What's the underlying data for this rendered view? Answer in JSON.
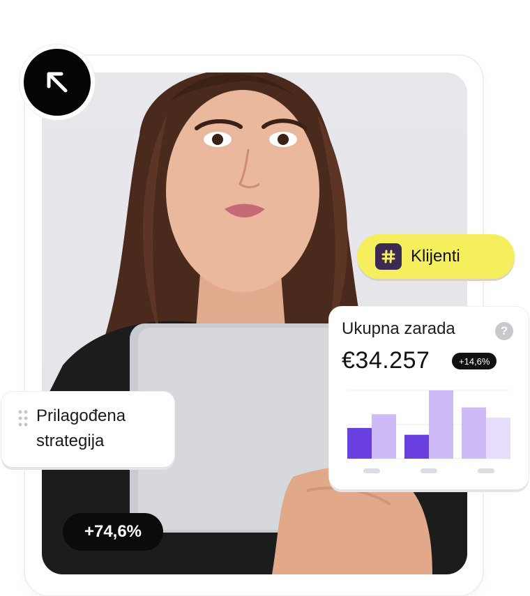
{
  "badges": {
    "clients_label": "Klijenti",
    "strategy_label_line1": "Prilagođena",
    "strategy_label_line2": "strategija",
    "growth_value": "+74,6%"
  },
  "earnings_card": {
    "title": "Ukupna zarada",
    "help_symbol": "?",
    "amount": "€34.257",
    "delta": "+14,6%"
  },
  "icons": {
    "arrow": "arrow-up-left-icon",
    "hash": "hash-icon",
    "help": "question-mark-icon",
    "drag": "drag-handle-icon"
  },
  "colors": {
    "accent_yellow": "#f5ef5d",
    "hash_bg": "#3d2a52",
    "bar_dark": "#6a3fe0",
    "bar_light": "#cfbaf8",
    "bar_lighter": "#e6dcfb",
    "pill_dark": "#0b0b0b"
  },
  "chart_data": {
    "type": "bar",
    "categories": [
      "",
      "",
      ""
    ],
    "series": [
      {
        "values": [
          45,
          35,
          75
        ]
      },
      {
        "values": [
          65,
          100,
          60
        ]
      }
    ],
    "ylim": [
      0,
      100
    ],
    "grid": true
  }
}
